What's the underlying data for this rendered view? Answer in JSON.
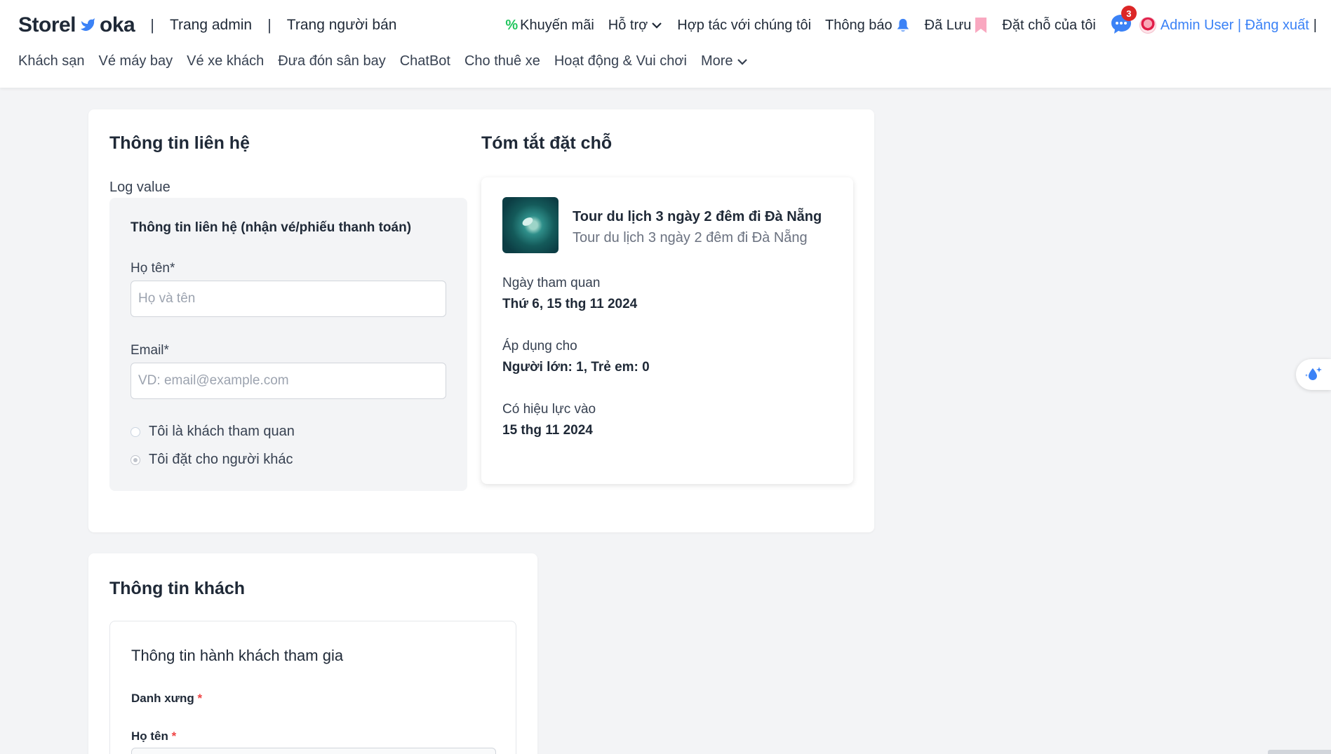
{
  "header": {
    "logo_left": "Storel",
    "logo_right": "oka",
    "admin_link": "Trang admin",
    "seller_link": "Trang người bán",
    "sep": "|",
    "promo": "Khuyến mãi",
    "promo_symbol": "%",
    "support": "Hỗ trợ",
    "partner": "Hợp tác với chúng tôi",
    "notifications": "Thông báo",
    "saved": "Đã Lưu",
    "my_bookings": "Đặt chỗ của tôi",
    "chat_badge": "3",
    "user": "Admin User | Đăng xuất",
    "trailing_bar": "|",
    "accent_color": "#3b82f6"
  },
  "nav": {
    "items": [
      "Khách sạn",
      "Vé máy bay",
      "Vé xe khách",
      "Đưa đón sân bay",
      "ChatBot",
      "Cho thuê xe",
      "Hoạt động & Vui chơi"
    ],
    "more": "More"
  },
  "contact": {
    "title": "Thông tin liên hệ",
    "log_value": "Log value",
    "box_title": "Thông tin liên hệ (nhận vé/phiếu thanh toán)",
    "name_label": "Họ tên*",
    "name_placeholder": "Họ và tên",
    "name_value": "",
    "email_label": "Email*",
    "email_placeholder": "VD: email@example.com",
    "email_value": "",
    "radio_visitor": "Tôi là khách tham quan",
    "radio_other": "Tôi đặt cho người khác"
  },
  "summary": {
    "title": "Tóm tắt đặt chỗ",
    "tour_title": "Tour du lịch 3 ngày 2 đêm đi Đà Nẵng",
    "tour_sub": "Tour du lịch 3 ngày 2 đêm đi Đà Nẵng",
    "visit_label": "Ngày tham quan",
    "visit_value": "Thứ 6, 15 thg 11 2024",
    "apply_label": "Áp dụng cho",
    "apply_value": "Người lớn: 1, Trẻ em: 0",
    "valid_label": "Có hiệu lực vào",
    "valid_value": "15 thg 11 2024"
  },
  "guest": {
    "title": "Thông tin khách",
    "box_title": "Thông tin hành khách tham gia",
    "salutation_label": "Danh xưng",
    "name_label": "Họ tên",
    "required_mark": "*"
  }
}
